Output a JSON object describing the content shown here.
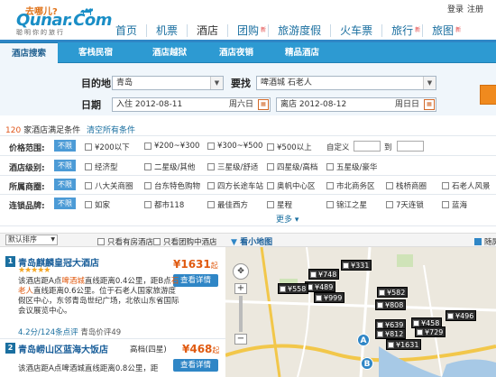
{
  "header": {
    "slogan": "去哪儿?",
    "logo": "Qunar.Com",
    "tagline": "聪明你的旅行",
    "util_login": "登录",
    "util_register": "注册",
    "nav": [
      {
        "label": "首页",
        "badge": ""
      },
      {
        "label": "机票",
        "badge": ""
      },
      {
        "label": "酒店",
        "badge": ""
      },
      {
        "label": "团购",
        "badge": "新"
      },
      {
        "label": "旅游度假",
        "badge": ""
      },
      {
        "label": "火车票",
        "badge": ""
      },
      {
        "label": "旅行",
        "badge": "新"
      },
      {
        "label": "旅图",
        "badge": "新"
      }
    ]
  },
  "subtabs": [
    "酒店搜索",
    "客栈民宿",
    "酒店越狱",
    "酒店夜销",
    "精品酒店"
  ],
  "search": {
    "dest_label": "目的地",
    "dest_value": "青岛",
    "near_label": "要找",
    "near_value": "啤酒城 石老人",
    "date_label": "日期",
    "checkin": "入住 2012-08-11",
    "checkin_day": "周六日",
    "checkout": "离店 2012-08-12",
    "checkout_day": "周日日"
  },
  "results": {
    "count": "120",
    "count_text": "家酒店满足条件",
    "clear_link": "清空所有条件"
  },
  "filters": {
    "no_limit": "不限",
    "price": {
      "label": "价格范围:",
      "options": [
        "¥200以下",
        "¥200~¥300",
        "¥300~¥500",
        "¥500以上"
      ],
      "custom": "自定义",
      "to": "到"
    },
    "star": {
      "label": "酒店级别:",
      "options": [
        "经济型",
        "二星级/其他",
        "三星级/舒适",
        "四星级/高档",
        "五星级/豪华"
      ]
    },
    "area": {
      "label": "所属商圈:",
      "options": [
        "八大关商圈",
        "台东特色购物",
        "四方长途车站",
        "奥帆中心区",
        "市北商务区",
        "栈桥商圈",
        "石老人风景"
      ]
    },
    "chain": {
      "label": "连锁品牌:",
      "options": [
        "如家",
        "都市118",
        "7天连锁",
        "星程",
        "锦江之星",
        "7天连锁",
        "蓝海"
      ],
      "options_display": [
        "如家",
        "都市118",
        "最佳西方",
        "星程",
        "锦江之星",
        "7天连锁",
        "蓝海"
      ]
    },
    "more": "更多 ▾"
  },
  "list_toolbar": {
    "sort": "默认排序",
    "only_available": "只看有房酒店",
    "only_group": "只看团购中酒店"
  },
  "hotels": [
    {
      "num": "1",
      "name": "青岛麒麟皇冠大酒店",
      "stars": "★★★★★",
      "price": "¥1631",
      "price_unit": "起",
      "button": "查看详情",
      "desc_a": "该酒店距A点",
      "desc_a_hl": "啤酒城",
      "desc_a_rest": "直线距离0.4公里，距",
      "desc_b": "B点",
      "desc_b_hl": "石老人",
      "desc_b_rest": "直线距离0.6公里。位于石老人国家旅游度假区中心，东邻青岛世纪广场，北依山东省国际会议展览中心。",
      "review": "4.2分/124条点评",
      "review_extra": "青岛价评49"
    },
    {
      "num": "2",
      "name": "青岛崂山区蓝海大饭店",
      "grade": "高档(四星)",
      "price": "¥468",
      "price_unit": "起",
      "button": "查看详情",
      "desc": "该酒店距A点啤酒城直线距离0.8公里，距"
    }
  ],
  "map": {
    "title": "看小地图",
    "toggle": "随屏",
    "pins": [
      "¥331",
      "¥748",
      "¥489",
      "¥558",
      "¥999",
      "¥582",
      "¥808",
      "¥639",
      "¥458",
      "¥496",
      "¥812",
      "¥729",
      "¥1631"
    ],
    "markers": [
      "A",
      "B"
    ]
  }
}
